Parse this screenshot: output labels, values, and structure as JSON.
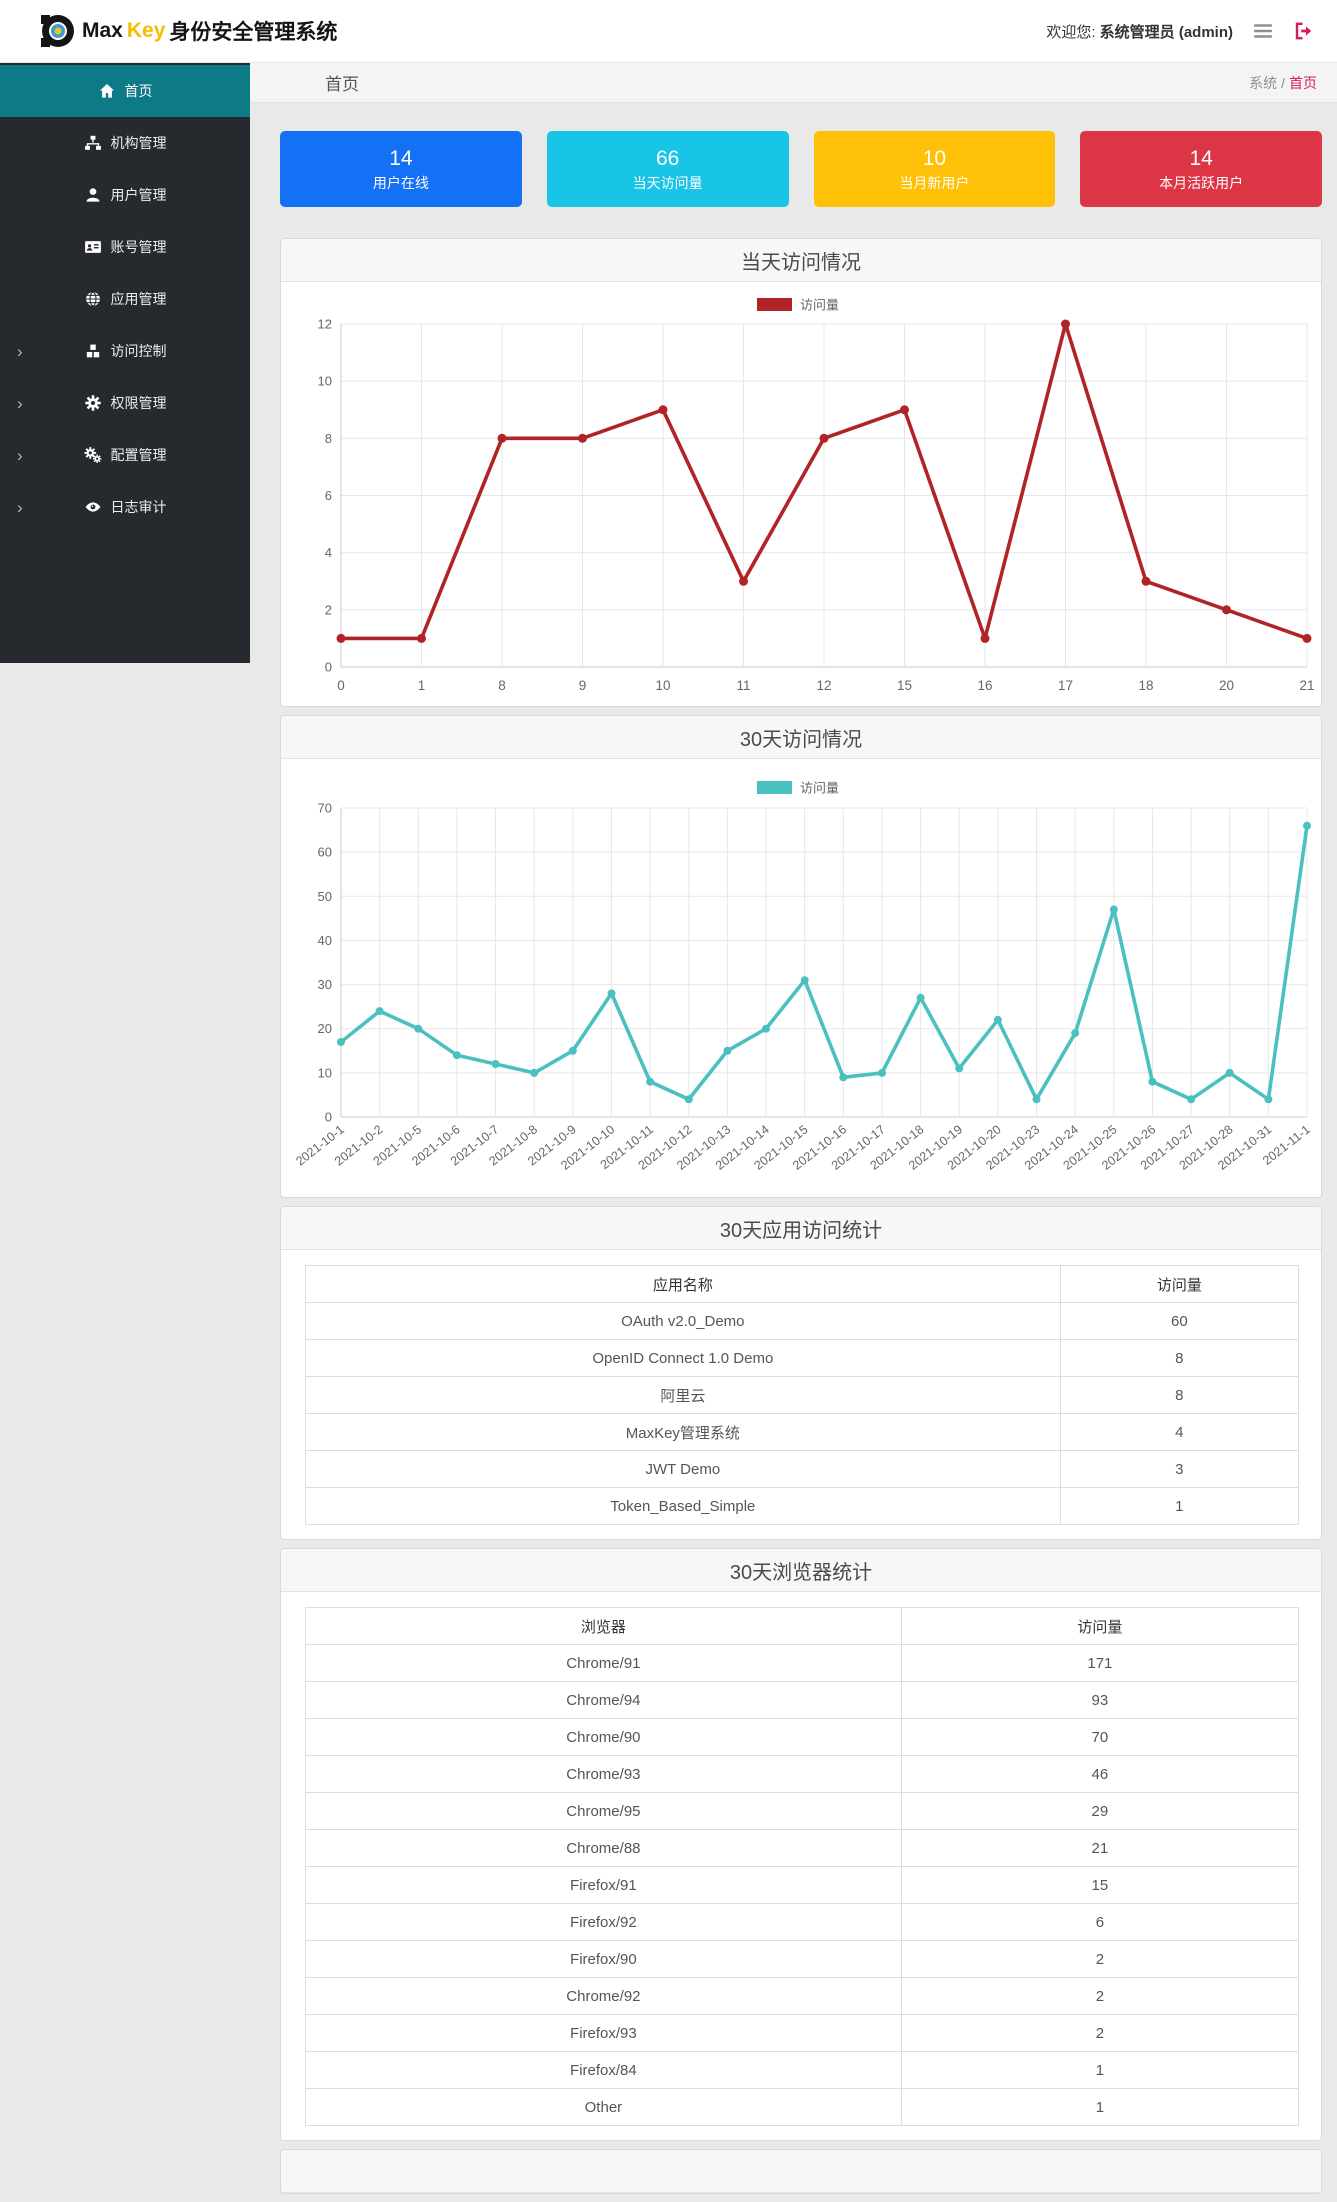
{
  "colors": {
    "accent_pink": "#d81b60",
    "sidebar_active_teal": "#0d7a85",
    "brand_gold": "#f5bd00",
    "sidebar_bg": "#26292e"
  },
  "header": {
    "brand_max": "Max",
    "brand_key": "Key",
    "brand_suffix": "身份安全管理系统",
    "welcome_label": "欢迎您:",
    "username": "系统管理员 (admin)"
  },
  "breadcrumb": {
    "page_title": "首页",
    "root": "系统",
    "separator": "/",
    "current": "首页"
  },
  "sidebar": {
    "items": [
      {
        "id": "home",
        "label": "首页",
        "icon": "home-icon",
        "active": true,
        "expandable": false
      },
      {
        "id": "org",
        "label": "机构管理",
        "icon": "sitemap-icon",
        "active": false,
        "expandable": false
      },
      {
        "id": "user",
        "label": "用户管理",
        "icon": "user-icon",
        "active": false,
        "expandable": false
      },
      {
        "id": "account",
        "label": "账号管理",
        "icon": "id-card-icon",
        "active": false,
        "expandable": false
      },
      {
        "id": "app",
        "label": "应用管理",
        "icon": "globe-icon",
        "active": false,
        "expandable": false
      },
      {
        "id": "access",
        "label": "访问控制",
        "icon": "cubes-icon",
        "active": false,
        "expandable": true
      },
      {
        "id": "permission",
        "label": "权限管理",
        "icon": "cog-icon",
        "active": false,
        "expandable": true
      },
      {
        "id": "config",
        "label": "配置管理",
        "icon": "cogs-icon",
        "active": false,
        "expandable": true
      },
      {
        "id": "audit",
        "label": "日志审计",
        "icon": "eye-icon",
        "active": false,
        "expandable": true
      }
    ]
  },
  "stat_cards": [
    {
      "value": "14",
      "label": "用户在线",
      "color": "#1470f4"
    },
    {
      "value": "66",
      "label": "当天访问量",
      "color": "#19c5e6"
    },
    {
      "value": "10",
      "label": "当月新用户",
      "color": "#fec107"
    },
    {
      "value": "14",
      "label": "本月活跃用户",
      "color": "#dc3545"
    }
  ],
  "chart_data": [
    {
      "type": "line",
      "title": "当天访问情况",
      "legend": "访问量",
      "legend_position": "top",
      "color": "#b02428",
      "grid": true,
      "categories": [
        "0",
        "1",
        "8",
        "9",
        "10",
        "11",
        "12",
        "15",
        "16",
        "17",
        "18",
        "20",
        "21"
      ],
      "values": [
        1,
        1,
        8,
        8,
        9,
        3,
        8,
        9,
        1,
        12,
        3,
        2,
        1
      ],
      "xlabel": "",
      "ylabel": "",
      "ylim": [
        0,
        12
      ],
      "ytick_step": 2,
      "rotate_labels": false
    },
    {
      "type": "line",
      "title": "30天访问情况",
      "legend": "访问量",
      "legend_position": "top",
      "color": "#4bc0c0",
      "grid": true,
      "categories": [
        "2021-10-1",
        "2021-10-2",
        "2021-10-5",
        "2021-10-6",
        "2021-10-7",
        "2021-10-8",
        "2021-10-9",
        "2021-10-10",
        "2021-10-11",
        "2021-10-12",
        "2021-10-13",
        "2021-10-14",
        "2021-10-15",
        "2021-10-16",
        "2021-10-17",
        "2021-10-18",
        "2021-10-19",
        "2021-10-20",
        "2021-10-23",
        "2021-10-24",
        "2021-10-25",
        "2021-10-26",
        "2021-10-27",
        "2021-10-28",
        "2021-10-31",
        "2021-11-1"
      ],
      "values": [
        17,
        24,
        20,
        14,
        12,
        10,
        15,
        28,
        8,
        4,
        15,
        20,
        31,
        9,
        10,
        27,
        11,
        22,
        4,
        19,
        47,
        8,
        4,
        10,
        4,
        66
      ],
      "xlabel": "",
      "ylabel": "",
      "ylim": [
        0,
        70
      ],
      "ytick_step": 10,
      "rotate_labels": true
    }
  ],
  "tables": [
    {
      "title": "30天应用访问统计",
      "headers": [
        "应用名称",
        "访问量"
      ],
      "col_widths": [
        "76%",
        "24%"
      ],
      "rows": [
        [
          "OAuth v2.0_Demo",
          60
        ],
        [
          "OpenID Connect 1.0 Demo",
          8
        ],
        [
          "阿里云",
          8
        ],
        [
          "MaxKey管理系统",
          4
        ],
        [
          "JWT Demo",
          3
        ],
        [
          "Token_Based_Simple",
          1
        ]
      ]
    },
    {
      "title": "30天浏览器统计",
      "headers": [
        "浏览器",
        "访问量"
      ],
      "col_widths": [
        "60%",
        "40%"
      ],
      "rows": [
        [
          "Chrome/91",
          171
        ],
        [
          "Chrome/94",
          93
        ],
        [
          "Chrome/90",
          70
        ],
        [
          "Chrome/93",
          46
        ],
        [
          "Chrome/95",
          29
        ],
        [
          "Chrome/88",
          21
        ],
        [
          "Firefox/91",
          15
        ],
        [
          "Firefox/92",
          6
        ],
        [
          "Firefox/90",
          2
        ],
        [
          "Chrome/92",
          2
        ],
        [
          "Firefox/93",
          2
        ],
        [
          "Firefox/84",
          1
        ],
        [
          "Other",
          1
        ]
      ]
    }
  ]
}
